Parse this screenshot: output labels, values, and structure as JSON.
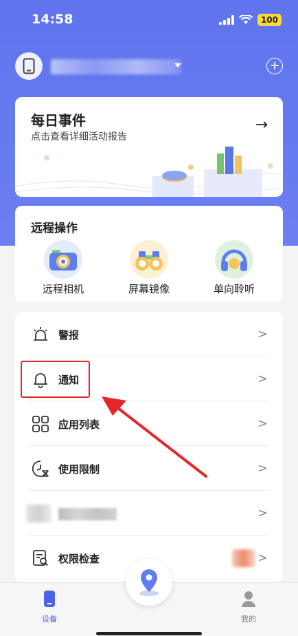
{
  "status_bar": {
    "time": "14:58",
    "battery": "100"
  },
  "daily_events": {
    "title": "每日事件",
    "subtitle": "点击查看详细活动报告"
  },
  "remote_ops": {
    "title": "远程操作",
    "items": [
      {
        "label": "远程相机",
        "icon": "camera-icon"
      },
      {
        "label": "屏幕镜像",
        "icon": "binoculars-icon"
      },
      {
        "label": "单向聆听",
        "icon": "headphones-icon"
      }
    ]
  },
  "menu": {
    "items": [
      {
        "label": "警报",
        "icon": "alarm-icon"
      },
      {
        "label": "通知",
        "icon": "bell-icon"
      },
      {
        "label": "应用列表",
        "icon": "app-grid-icon"
      },
      {
        "label": "使用限制",
        "icon": "clock-limit-icon"
      },
      {
        "label": "",
        "icon": "blurred-icon"
      },
      {
        "label": "权限检查",
        "icon": "permission-check-icon"
      }
    ]
  },
  "bottom_nav": {
    "devices_label": "设备",
    "mine_label": "我的"
  },
  "colors": {
    "brand": "#5f73ee",
    "active_nav": "#4a64e8",
    "highlight": "#e8262a"
  }
}
